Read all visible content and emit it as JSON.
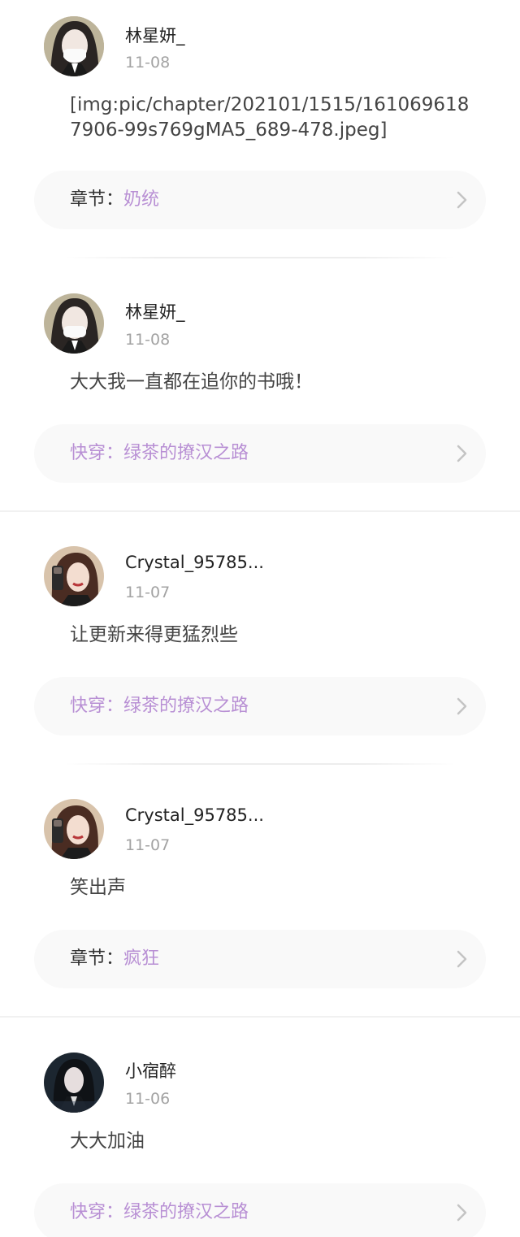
{
  "colors": {
    "book_link": "#b88fd4",
    "username": "#222222",
    "date": "#a3a3a3",
    "content": "#444444",
    "card_bg": "#f9f9f9"
  },
  "comments": [
    {
      "username": "林星妍_",
      "date": "11-08",
      "content": "[img:pic/chapter/202101/1515/1610696187906-99s769gMA5_689-478.jpeg]",
      "link_prefix": "章节：",
      "link_text": "奶统",
      "avatar_icon": "user-avatar-masked-girl"
    },
    {
      "username": "林星妍_",
      "date": "11-08",
      "content": "大大我一直都在追你的书哦！",
      "link_prefix": "",
      "link_text": "快穿：绿茶的撩汉之路",
      "avatar_icon": "user-avatar-masked-girl"
    },
    {
      "username": "Crystal_95785...",
      "date": "11-07",
      "content": "让更新来得更猛烈些",
      "link_prefix": "",
      "link_text": "快穿：绿茶的撩汉之路",
      "avatar_icon": "user-avatar-mirror-selfie"
    },
    {
      "username": "Crystal_95785...",
      "date": "11-07",
      "content": "笑出声",
      "link_prefix": "章节：",
      "link_text": "疯狂",
      "avatar_icon": "user-avatar-mirror-selfie"
    },
    {
      "username": "小宿醉",
      "date": "11-06",
      "content": "大大加油",
      "link_prefix": "",
      "link_text": "快穿：绿茶的撩汉之路",
      "avatar_icon": "user-avatar-dark-portrait"
    }
  ]
}
